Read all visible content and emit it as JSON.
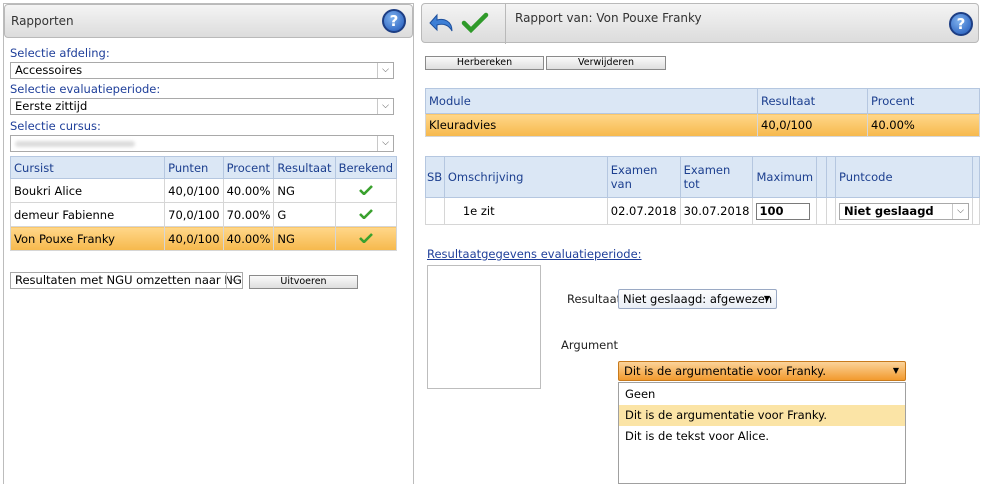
{
  "left": {
    "title": "Rapporten",
    "afdeling_label": "Selectie afdeling:",
    "afdeling_value": "Accessoires",
    "periode_label": "Selectie evaluatieperiode:",
    "periode_value": "Eerste zittijd",
    "cursus_label": "Selectie cursus:",
    "cursus_value": "",
    "table": {
      "headers": [
        "Cursist",
        "Punten",
        "Procent",
        "Resultaat",
        "Berekend"
      ],
      "rows": [
        {
          "cursist": "Boukri Alice",
          "punten": "40,0/100",
          "procent": "40.00%",
          "resultaat": "NG"
        },
        {
          "cursist": "demeur Fabienne",
          "punten": "70,0/100",
          "procent": "70.00%",
          "resultaat": "G"
        },
        {
          "cursist": "Von Pouxe Franky",
          "punten": "40,0/100",
          "procent": "40.00%",
          "resultaat": "NG"
        }
      ]
    },
    "ngu_select_value": "Resultaten met NGU omzetten naar NG",
    "uitvoeren_label": "Uitvoeren"
  },
  "right": {
    "title": "Rapport van: Von Pouxe Franky",
    "herbereken_label": "Herbereken",
    "verwijderen_label": "Verwijderen",
    "module_table": {
      "headers": [
        "Module",
        "Resultaat",
        "Procent"
      ],
      "row": {
        "module": "Kleuradvies",
        "resultaat": "40,0/100",
        "procent": "40.00%"
      }
    },
    "exam_table": {
      "headers": [
        "SB",
        "Omschrijving",
        "Examen van",
        "Examen tot",
        "Maximum",
        "",
        "",
        "Puntcode"
      ],
      "row": {
        "omschrijving": "1e zit",
        "van": "02.07.2018",
        "tot": "30.07.2018",
        "maximum": "100",
        "puntcode": "Niet geslaagd"
      }
    },
    "result_link": "Resultaatgegevens evaluatieperiode:",
    "resultaat_label": "Resultaat",
    "resultaat_value": "Niet geslaagd: afgewezen",
    "argument_label": "Argument",
    "argument_value": "Dit is de argumentatie voor Franky.",
    "argument_options": [
      "Geen",
      "Dit is de argumentatie voor Franky.",
      "Dit is de tekst voor Alice."
    ]
  },
  "colors": {
    "accent": "#1f3f9a",
    "selected": "#f6b84c",
    "header_bg": "#dbe7f5"
  }
}
